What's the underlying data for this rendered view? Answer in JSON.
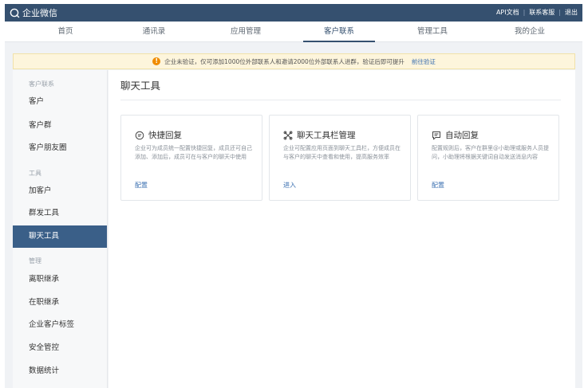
{
  "topbar": {
    "brand": "企业微信",
    "links": [
      "API文档",
      "联系客服",
      "退出"
    ]
  },
  "nav": {
    "items": [
      "首页",
      "通讯录",
      "应用管理",
      "客户联系",
      "管理工具",
      "我的企业"
    ],
    "active": "客户联系"
  },
  "notice": {
    "text": "企业未验证，仅可添加1000位外部联系人和邀请2000位外部联系人进群，验证后即可提升",
    "link": "前往验证"
  },
  "sidebar": {
    "sections": [
      {
        "title": "客户联系",
        "items": [
          "客户",
          "客户群",
          "客户朋友圈"
        ]
      },
      {
        "title": "工具",
        "items": [
          "加客户",
          "群发工具",
          "聊天工具"
        ]
      },
      {
        "title": "管理",
        "items": [
          "离职继承",
          "在职继承",
          "企业客户标签",
          "安全管控",
          "数据统计"
        ]
      }
    ],
    "active": "聊天工具"
  },
  "main": {
    "title": "聊天工具",
    "cards": [
      {
        "icon": "quick-reply-icon",
        "title": "快捷回复",
        "desc": "企业可为成员统一配置快捷回复，成员还可自己添加、添加后，成员可在与客户的聊天中使用",
        "action": "配置"
      },
      {
        "icon": "toolbar-icon",
        "title": "聊天工具栏管理",
        "desc": "企业可配置应用页面到聊天工具栏，方便成员在与客户的聊天中查看和使用，提高服务效率",
        "action": "进入"
      },
      {
        "icon": "auto-reply-icon",
        "title": "自动回复",
        "desc": "配置规则后，客户在群里@小助理或服务人员提问，小助理将根据关键词自动发送消息内容",
        "action": "配置"
      }
    ]
  },
  "colors": {
    "topbar": "#35506f",
    "accent": "#3a5f88",
    "link": "#3a6fb0",
    "notice_bg": "#fdf5dc",
    "warning": "#f08c00"
  }
}
